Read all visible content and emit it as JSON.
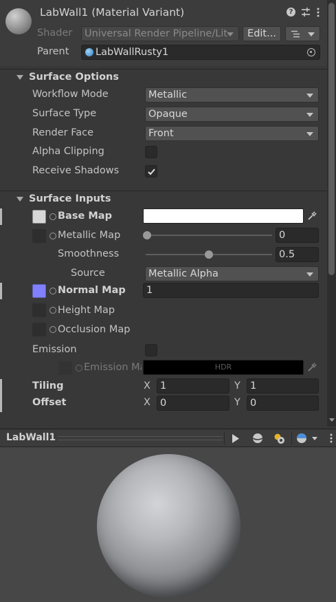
{
  "header": {
    "title": "LabWall1 (Material Variant)",
    "shader_label": "Shader",
    "shader_value": "Universal Render Pipeline/Lit",
    "edit_label": "Edit...",
    "parent_label": "Parent",
    "parent_value": "LabWallRusty1"
  },
  "surface_options": {
    "title": "Surface Options",
    "workflow_label": "Workflow Mode",
    "workflow_value": "Metallic",
    "surface_type_label": "Surface Type",
    "surface_type_value": "Opaque",
    "render_face_label": "Render Face",
    "render_face_value": "Front",
    "alpha_clipping_label": "Alpha Clipping",
    "alpha_clipping_checked": false,
    "receive_shadows_label": "Receive Shadows",
    "receive_shadows_checked": true
  },
  "surface_inputs": {
    "title": "Surface Inputs",
    "base_map_label": "Base Map",
    "base_map_color": "#ffffff",
    "metallic_map_label": "Metallic Map",
    "metallic_value": "0",
    "smoothness_label": "Smoothness",
    "smoothness_value": "0.5",
    "source_label": "Source",
    "source_value": "Metallic Alpha",
    "normal_map_label": "Normal Map",
    "normal_map_value": "1",
    "normal_map_color": "#8080ff",
    "height_map_label": "Height Map",
    "occlusion_map_label": "Occlusion Map",
    "emission_label": "Emission",
    "emission_checked": false,
    "emission_map_label": "Emission Map",
    "emission_hdr": "HDR",
    "tiling_label": "Tiling",
    "tiling_x": "1",
    "tiling_y": "1",
    "offset_label": "Offset",
    "offset_x": "0",
    "offset_y": "0",
    "x_label": "X",
    "y_label": "Y"
  },
  "preview": {
    "title": "LabWall1"
  },
  "colors": {
    "panel": "#383838",
    "section_header": "#3e3e3e",
    "field": "#2a2a2a",
    "dropdown": "#515151",
    "accent_blue": "#4a8fd8"
  }
}
